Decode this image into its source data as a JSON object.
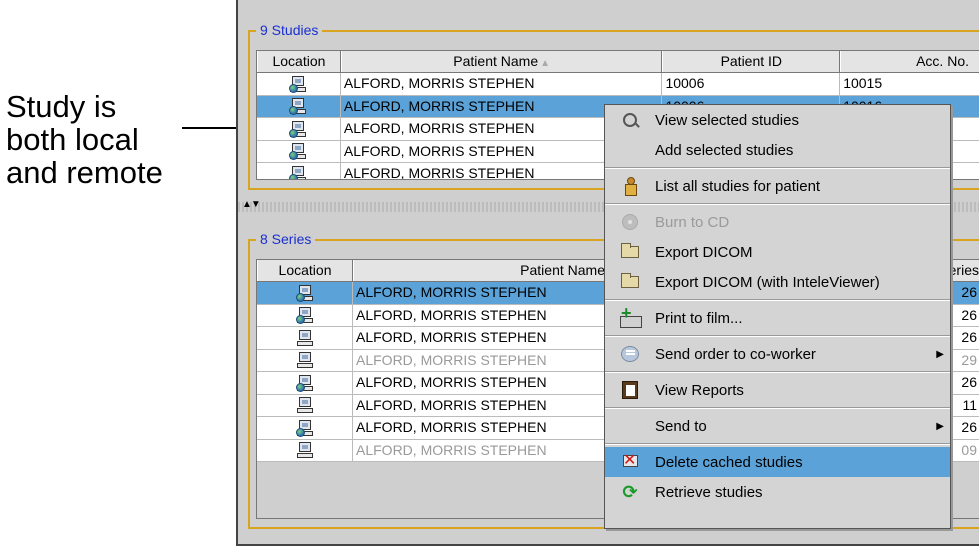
{
  "annotation": {
    "lines": [
      "Study is",
      "both local",
      "and remote"
    ]
  },
  "studies": {
    "title": "9 Studies",
    "columns": [
      "Location",
      "Patient Name",
      "Patient ID",
      "Acc. No."
    ],
    "rows": [
      {
        "name": "ALFORD, MORRIS STEPHEN",
        "patient_id": "10006",
        "acc_no": "10015",
        "selected": false
      },
      {
        "name": "ALFORD, MORRIS STEPHEN",
        "patient_id": "10006",
        "acc_no": "10016",
        "selected": true
      },
      {
        "name": "ALFORD, MORRIS STEPHEN",
        "patient_id": "",
        "acc_no": "",
        "selected": false
      },
      {
        "name": "ALFORD, MORRIS STEPHEN",
        "patient_id": "",
        "acc_no": "",
        "selected": false
      },
      {
        "name": "ALFORD, MORRIS STEPHEN",
        "patient_id": "",
        "acc_no": "",
        "selected": false
      }
    ]
  },
  "series": {
    "title": "8 Series",
    "columns": [
      "Location",
      "Patient Name",
      "Series"
    ],
    "rows": [
      {
        "name": "ALFORD, MORRIS STEPHEN",
        "tail": "26",
        "dim": false,
        "remote": true,
        "selected": true
      },
      {
        "name": "ALFORD, MORRIS STEPHEN",
        "tail": "26",
        "dim": false,
        "remote": true,
        "selected": false
      },
      {
        "name": "ALFORD, MORRIS STEPHEN",
        "tail": "26",
        "dim": false,
        "remote": false,
        "selected": false
      },
      {
        "name": "ALFORD, MORRIS STEPHEN",
        "tail": "29",
        "dim": true,
        "remote": false,
        "selected": false
      },
      {
        "name": "ALFORD, MORRIS STEPHEN",
        "tail": "26",
        "dim": false,
        "remote": true,
        "selected": false
      },
      {
        "name": "ALFORD, MORRIS STEPHEN",
        "tail": "11",
        "dim": false,
        "remote": false,
        "selected": false
      },
      {
        "name": "ALFORD, MORRIS STEPHEN",
        "tail": "26",
        "dim": false,
        "remote": true,
        "selected": false
      },
      {
        "name": "ALFORD, MORRIS STEPHEN",
        "tail": "09",
        "dim": true,
        "remote": false,
        "selected": false
      }
    ]
  },
  "context_menu": {
    "view_selected": "View selected studies",
    "add_selected": "Add selected studies",
    "list_all": "List all studies for patient",
    "burn_cd": "Burn to CD",
    "export_dicom": "Export DICOM",
    "export_dicom_viewer": "Export DICOM (with InteleViewer)",
    "print_film": "Print to film...",
    "send_order": "Send order to co-worker",
    "view_reports": "View Reports",
    "send_to": "Send to",
    "delete_cached": "Delete cached studies",
    "retrieve": "Retrieve studies"
  },
  "colors": {
    "selection": "#5aa2d8",
    "panel_title": "#1a2fd0",
    "panel_border": "#d9a520"
  }
}
